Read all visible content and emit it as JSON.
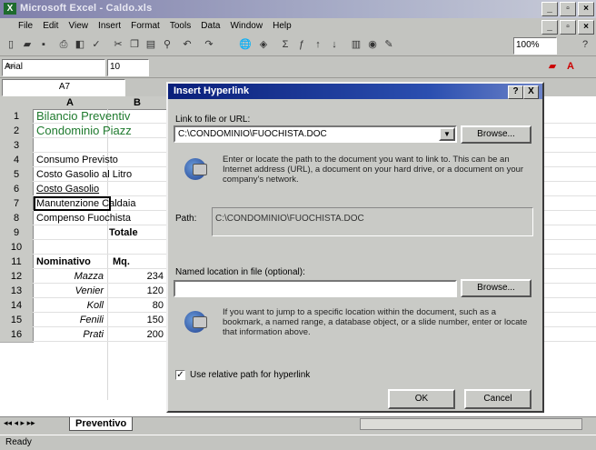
{
  "app": {
    "title": "Microsoft Excel - Caldo.xls"
  },
  "menu": [
    "File",
    "Edit",
    "View",
    "Insert",
    "Format",
    "Tools",
    "Data",
    "Window",
    "Help"
  ],
  "toolbar": {
    "zoom": "100%",
    "font": "Arial",
    "font_size": "10"
  },
  "namebox": {
    "cell": "A7"
  },
  "sheet": {
    "columns": [
      "A",
      "B"
    ],
    "rows": [
      {
        "n": "1",
        "a": "Bilancio Preventiv",
        "b": ""
      },
      {
        "n": "2",
        "a": "Condominio Piazz",
        "b": ""
      },
      {
        "n": "3",
        "a": "",
        "b": ""
      },
      {
        "n": "4",
        "a": "Consumo Previsto",
        "b": ""
      },
      {
        "n": "5",
        "a": "Costo Gasolio al Litro",
        "b": ""
      },
      {
        "n": "6",
        "a": "Costo Gasolio",
        "b": ""
      },
      {
        "n": "7",
        "a": "Manutenzione Caldaia",
        "b": ""
      },
      {
        "n": "8",
        "a": "Compenso Fuochista",
        "b": ""
      },
      {
        "n": "9",
        "a": "Totale",
        "b": ""
      },
      {
        "n": "10",
        "a": "",
        "b": ""
      },
      {
        "n": "11",
        "a": "Nominativo",
        "b": "Mq."
      },
      {
        "n": "12",
        "a": "Mazza",
        "b": "234"
      },
      {
        "n": "13",
        "a": "Venier",
        "b": "120"
      },
      {
        "n": "14",
        "a": "Koll",
        "b": "80"
      },
      {
        "n": "15",
        "a": "Fenili",
        "b": "150"
      },
      {
        "n": "16",
        "a": "Prati",
        "b": "200"
      }
    ],
    "sheet_tab": "Preventivo"
  },
  "status": {
    "text": "Ready"
  },
  "dialog": {
    "title": "Insert Hyperlink",
    "link_label": "Link to file or URL:",
    "link_value": "C:\\CONDOMINIO\\FUOCHISTA.DOC",
    "browse1": "Browse...",
    "help1": "Enter or locate the path to the document you want to link to. This can be an Internet address (URL), a document on your hard drive, or a document on your company's network.",
    "path_label": "Path:",
    "path_value": "C:\\CONDOMINIO\\FUOCHISTA.DOC",
    "named_label": "Named location in file (optional):",
    "named_value": "",
    "browse2": "Browse...",
    "help2": "If you want to jump to a specific location within the document, such as a bookmark, a named range, a database object, or a slide number, enter or locate that information above.",
    "relative_label": "Use relative path for hyperlink",
    "relative_checked": true,
    "ok": "OK",
    "cancel": "Cancel",
    "help_btn": "?",
    "close_btn": "X"
  }
}
